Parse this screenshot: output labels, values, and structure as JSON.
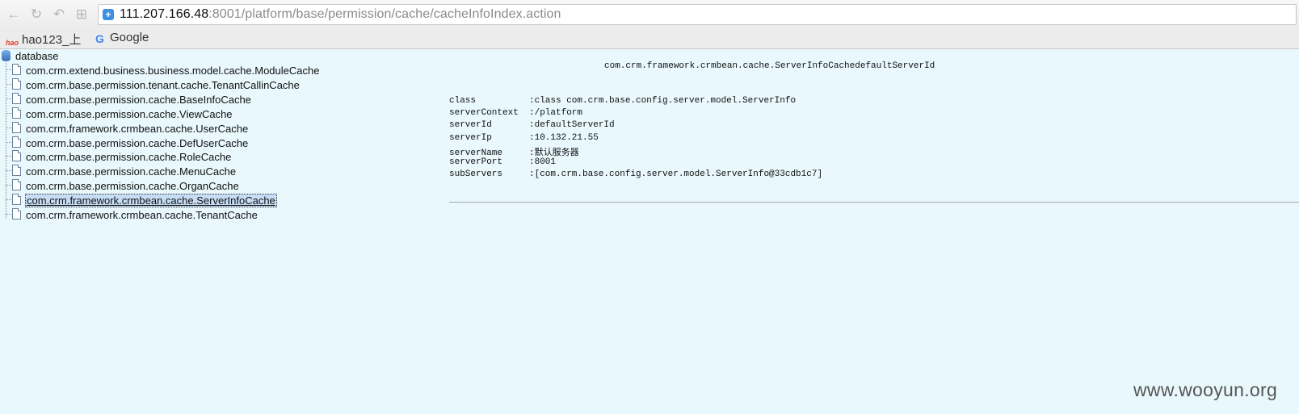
{
  "browser": {
    "url_host": "111.207.166.48",
    "url_rest": ":8001/platform/base/permission/cache/cacheInfoIndex.action",
    "bookmarks": [
      {
        "label": "hao123_上",
        "icon": "hao123-icon"
      },
      {
        "label": "Google",
        "icon": "google-icon"
      }
    ]
  },
  "tree": {
    "root_label": "database",
    "items": [
      "com.crm.extend.business.business.model.cache.ModuleCache",
      "com.crm.base.permission.tenant.cache.TenantCallinCache",
      "com.crm.base.permission.cache.BaseInfoCache",
      "com.crm.base.permission.cache.ViewCache",
      "com.crm.framework.crmbean.cache.UserCache",
      "com.crm.base.permission.cache.DefUserCache",
      "com.crm.base.permission.cache.RoleCache",
      "com.crm.base.permission.cache.MenuCache",
      "com.crm.base.permission.cache.OrganCache",
      "com.crm.framework.crmbean.cache.ServerInfoCache",
      "com.crm.framework.crmbean.cache.TenantCache"
    ],
    "selected_index": 9
  },
  "detail": {
    "title": "com.crm.framework.crmbean.cache.ServerInfoCachedefaultServerId",
    "properties": [
      {
        "key": "class",
        "value": ":class com.crm.base.config.server.model.ServerInfo"
      },
      {
        "key": "serverContext",
        "value": ":/platform"
      },
      {
        "key": "serverId",
        "value": ":defaultServerId"
      },
      {
        "key": "serverIp",
        "value": ":10.132.21.55"
      },
      {
        "key": "serverName",
        "value": ":默认服务器"
      },
      {
        "key": "serverPort",
        "value": ":8001"
      },
      {
        "key": "subServers",
        "value": ":[com.crm.base.config.server.model.ServerInfo@33cdb1c7]"
      }
    ]
  },
  "watermark": "www.wooyun.org"
}
